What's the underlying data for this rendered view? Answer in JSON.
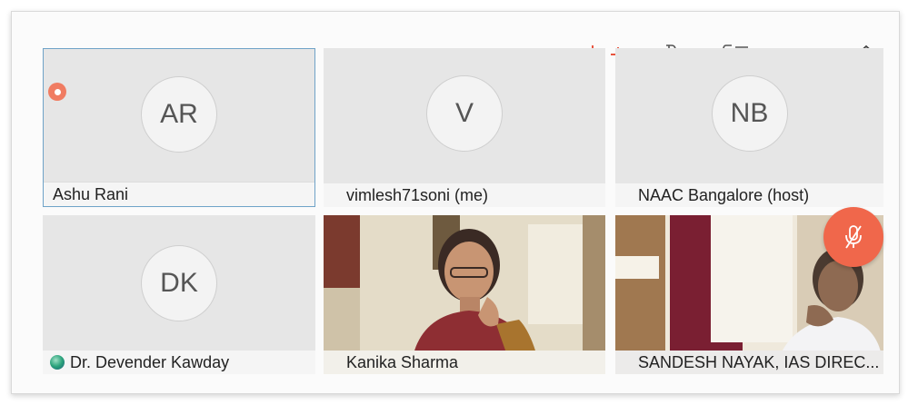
{
  "participants": [
    {
      "initials": "AR",
      "name": "Ashu Rani"
    },
    {
      "initials": "V",
      "name": "vimlesh71soni (me)"
    },
    {
      "initials": "NB",
      "name": "NAAC Bangalore (host)"
    },
    {
      "initials": "DK",
      "name": "Dr. Devender Kawday"
    },
    {
      "initials": "",
      "name": "Kanika Sharma"
    },
    {
      "initials": "",
      "name": "SANDESH NAYAK, IAS DIREC..."
    }
  ],
  "top_icons": [
    "switch-camera-icon",
    "touch-icon",
    "chat-list-icon",
    "collapse-icon"
  ],
  "colors": {
    "tile_bg": "#e6e6e6",
    "namebar_bg": "#f5f5f5",
    "accent_red": "#f0674b",
    "active_border": "#6fa3c8"
  }
}
